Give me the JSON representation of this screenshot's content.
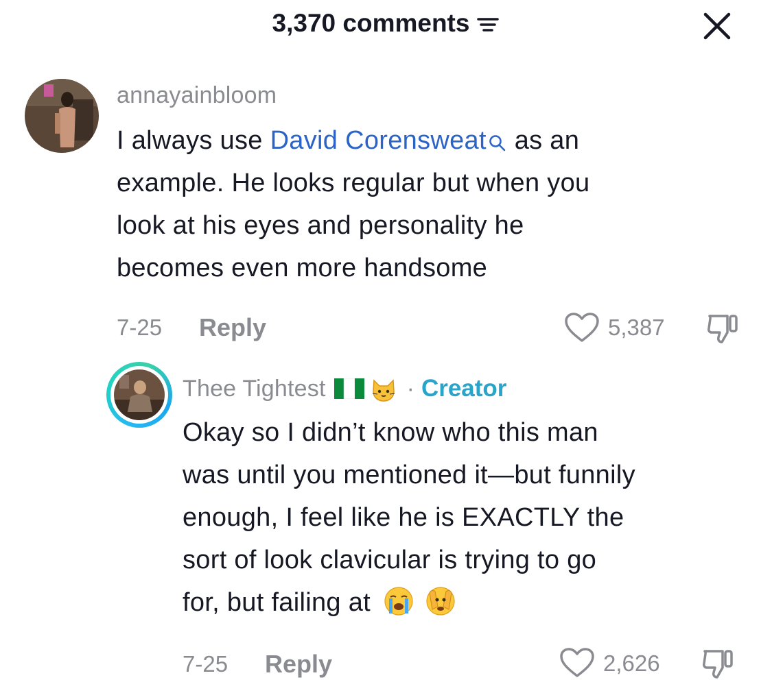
{
  "header": {
    "comment_count_label": "3,370 comments"
  },
  "comments": [
    {
      "username": "annayainbloom",
      "text_before": "I always use ",
      "mention": "David Corensweat",
      "line1_after": " as an",
      "line2": "example. He looks regular but when you",
      "line3": "look at his eyes and personality he",
      "line4": "becomes even more handsome",
      "date": "7-25",
      "reply_label": "Reply",
      "likes": "5,387"
    },
    {
      "username": "Thee Tightest",
      "separator": "·",
      "creator_label": "Creator",
      "line1": "Okay so I didn’t know who this man",
      "line2": "was until you mentioned it—but funnily",
      "line3": "enough, I feel like he is EXACTLY the",
      "line4": "sort of look clavicular is trying to go",
      "line5": "for, but failing at",
      "date": "7-25",
      "reply_label": "Reply",
      "likes": "2,626"
    }
  ],
  "colors": {
    "text": "#161823",
    "muted": "#8a8b91",
    "mention": "#2b64c6",
    "creator": "#2aa4c9"
  },
  "icons": [
    "sort-icon",
    "close-icon",
    "search-icon",
    "heart-icon",
    "dislike-icon",
    "nigeria-flag-icon",
    "cat-face-icon",
    "crying-face-icon",
    "face-with-peeking-eye-icon"
  ]
}
